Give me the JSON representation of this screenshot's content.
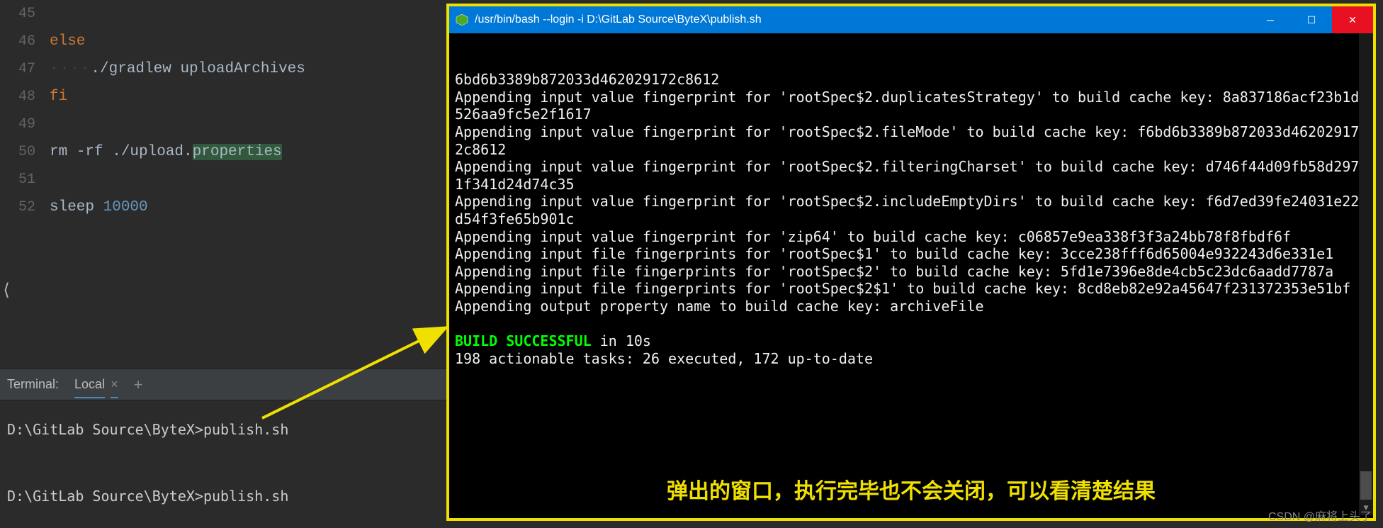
{
  "editor": {
    "lines": [
      {
        "num": "45",
        "html": ""
      },
      {
        "num": "46",
        "html": "<span class='kw'>else</span>"
      },
      {
        "num": "47",
        "html": "<span class='indent-dots'>····</span><span class='txt'>./gradlew </span><span class='cmd'>uploadArchives</span>"
      },
      {
        "num": "48",
        "html": "<span class='kw'>fi</span>"
      },
      {
        "num": "49",
        "html": ""
      },
      {
        "num": "50",
        "html": "<span class='cmd'>rm </span><span class='txt'>-rf ./upload.</span><span class='highlight-bg txt'>properties</span>"
      },
      {
        "num": "51",
        "html": ""
      },
      {
        "num": "52",
        "html": "<span class='cmd'>sleep </span><span class='num'>10000</span>"
      }
    ]
  },
  "terminal": {
    "label": "Terminal:",
    "tab": "Local",
    "lines": "D:\\GitLab Source\\ByteX>publish.sh\n\nD:\\GitLab Source\\ByteX>publish.sh"
  },
  "bash": {
    "title": "/usr/bin/bash --login -i D:\\GitLab Source\\ByteX\\publish.sh",
    "output": [
      "6bd6b3389b872033d462029172c8612",
      "Appending input value fingerprint for 'rootSpec$2.duplicatesStrategy' to build cache key: 8a837186acf23b1d526aa9fc5e2f1617",
      "Appending input value fingerprint for 'rootSpec$2.fileMode' to build cache key: f6bd6b3389b872033d462029172c8612",
      "Appending input value fingerprint for 'rootSpec$2.filteringCharset' to build cache key: d746f44d09fb58d2971f341d24d74c35",
      "Appending input value fingerprint for 'rootSpec$2.includeEmptyDirs' to build cache key: f6d7ed39fe24031e22d54f3fe65b901c",
      "Appending input value fingerprint for 'zip64' to build cache key: c06857e9ea338f3f3a24bb78f8fbdf6f",
      "Appending input file fingerprints for 'rootSpec$1' to build cache key: 3cce238fff6d65004e932243d6e331e1",
      "Appending input file fingerprints for 'rootSpec$2' to build cache key: 5fd1e7396e8de4cb5c23dc6aadd7787a",
      "Appending input file fingerprints for 'rootSpec$2$1' to build cache key: 8cd8eb82e92a45647f231372353e51bf",
      "Appending output property name to build cache key: archiveFile"
    ],
    "success_prefix": "BUILD SUCCESSFUL",
    "success_suffix": " in 10s",
    "tasks": "198 actionable tasks: 26 executed, 172 up-to-date"
  },
  "annotation": "弹出的窗口，执行完毕也不会关闭，可以看清楚结果",
  "watermark": "CSDN @麻将上头了"
}
